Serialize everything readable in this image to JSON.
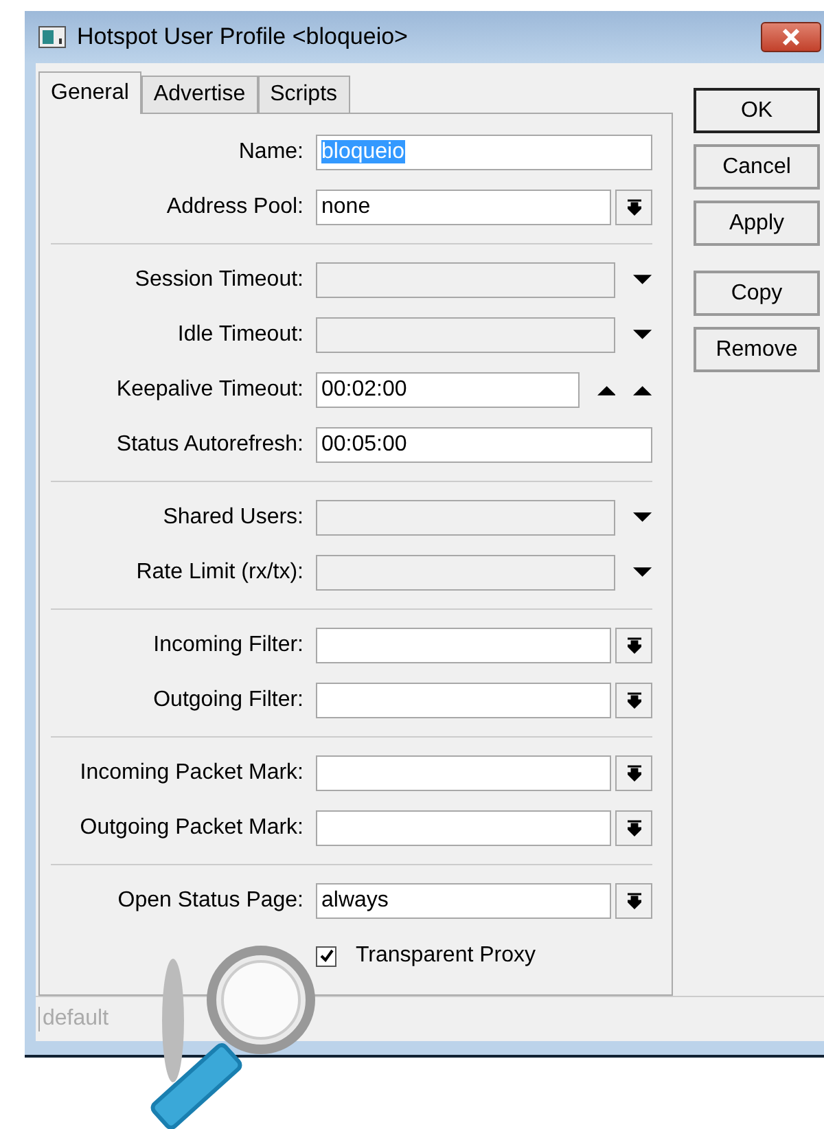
{
  "window": {
    "title": "Hotspot User Profile <bloqueio>"
  },
  "tabs": [
    {
      "label": "General",
      "selected": true
    },
    {
      "label": "Advertise",
      "selected": false
    },
    {
      "label": "Scripts",
      "selected": false
    }
  ],
  "groups": [
    {
      "rows": [
        {
          "kind": "text",
          "label": "Name:",
          "value": "bloqueio",
          "value_selected": true
        },
        {
          "kind": "dropdown",
          "label": "Address Pool:",
          "value": "none"
        }
      ]
    },
    {
      "rows": [
        {
          "kind": "unset",
          "label": "Session Timeout:"
        },
        {
          "kind": "unset",
          "label": "Idle Timeout:"
        },
        {
          "kind": "spin",
          "label": "Keepalive Timeout:",
          "value": "00:02:00"
        },
        {
          "kind": "text",
          "label": "Status Autorefresh:",
          "value": "00:05:00",
          "value_selected": false
        }
      ]
    },
    {
      "rows": [
        {
          "kind": "unset",
          "label": "Shared Users:"
        },
        {
          "kind": "unset",
          "label": "Rate Limit (rx/tx):"
        }
      ]
    },
    {
      "rows": [
        {
          "kind": "dropdown",
          "label": "Incoming Filter:"
        },
        {
          "kind": "dropdown",
          "label": "Outgoing Filter:"
        }
      ]
    },
    {
      "rows": [
        {
          "kind": "dropdown",
          "label": "Incoming Packet Mark:"
        },
        {
          "kind": "dropdown",
          "label": "Outgoing Packet Mark:"
        }
      ]
    },
    {
      "rows": [
        {
          "kind": "dropdown",
          "label": "Open Status Page:",
          "value": "always"
        },
        {
          "kind": "checkbox",
          "label": "Transparent Proxy",
          "checked": true
        }
      ]
    }
  ],
  "button_groups": [
    {
      "buttons": [
        "OK",
        "Cancel",
        "Apply"
      ]
    },
    {
      "buttons": [
        "Copy",
        "Remove"
      ]
    }
  ],
  "status_bar": {
    "text": "default"
  }
}
